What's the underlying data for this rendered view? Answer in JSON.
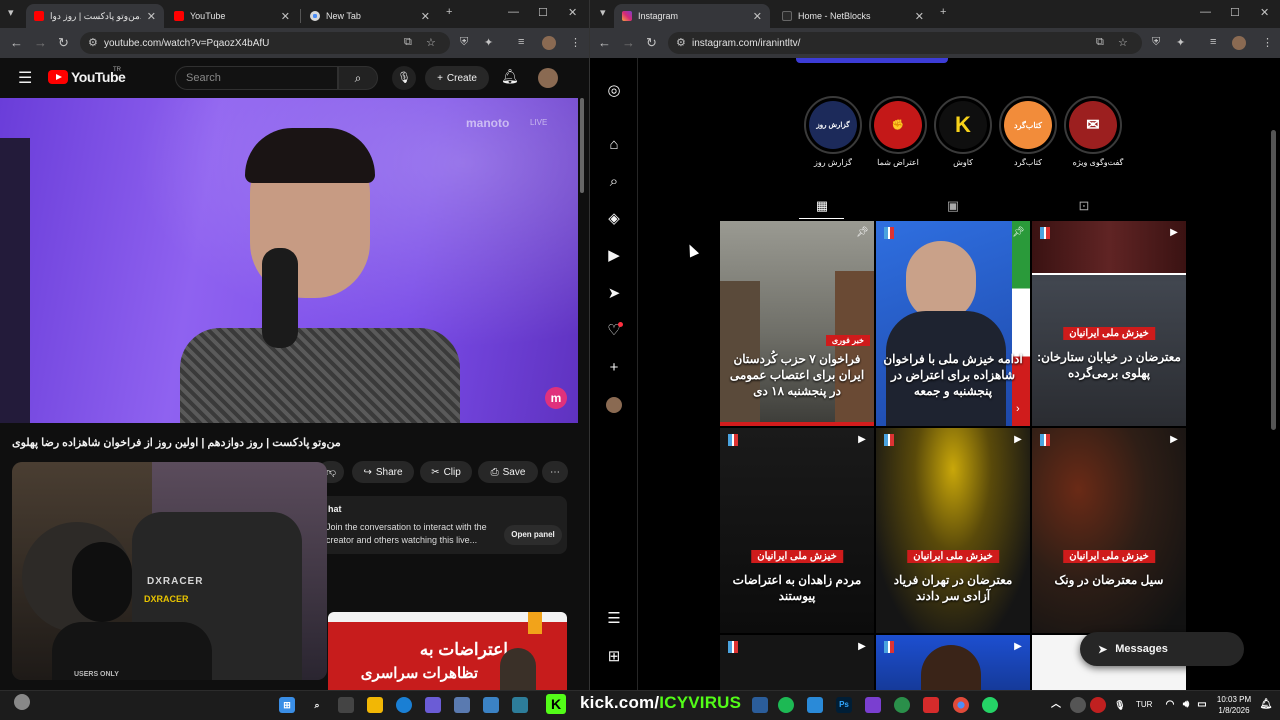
{
  "left_browser": {
    "tabs": [
      {
        "label": "من‌وتو پادکست | روز دوا...",
        "favicon": "youtube-red"
      },
      {
        "label": "YouTube",
        "favicon": "youtube-red"
      },
      {
        "label": "New Tab",
        "favicon": "chrome"
      }
    ],
    "url": "youtube.com/watch?v=PqaozX4bAfU"
  },
  "right_browser": {
    "tabs": [
      {
        "label": "Instagram",
        "favicon": "instagram"
      },
      {
        "label": "Home - NetBlocks",
        "favicon": "netblocks"
      }
    ],
    "url": "instagram.com/iranintltv/"
  },
  "youtube": {
    "logo_text": "YouTube",
    "logo_sup": "TR",
    "search_placeholder": "Search",
    "create_label": "Create",
    "watermark": "manoto",
    "watermark_live": "LIVE",
    "video_title": "من‌وتو پادکست | روز دوازدهم | اولین روز از فراخوان شاهزاده رضا پهلوی",
    "actions": {
      "share": "Share",
      "clip": "Clip",
      "save": "Save"
    },
    "chat": {
      "heading": "hat",
      "text": "Join the conversation to interact with the creator and others watching this live...",
      "open_panel": "Open panel"
    },
    "ad_text": "اعتراضات به",
    "ad_text2": "تظاهرات سراسری",
    "webcam_brand": "DXRACER",
    "webcam_brand2": "DXRACER",
    "webcam_footer": "USERS ONLY"
  },
  "instagram": {
    "highlights": [
      {
        "label": "گزارش روز",
        "icon_text": "گزارش روز",
        "bg": "#1c2a5a"
      },
      {
        "label": "اعتراض شما",
        "icon_text": "✊",
        "bg": "#c41818"
      },
      {
        "label": "کاوش",
        "icon_text": "K",
        "bg": "#0f0f0f"
      },
      {
        "label": "کتاب‌گرد",
        "icon_text": "کتاب‌گرد",
        "bg": "#f28c3a"
      },
      {
        "label": "گفت‌وگوی ویژه",
        "icon_text": "✉",
        "bg": "#9c1f1f"
      }
    ],
    "posts": [
      {
        "tag": "خبر فوری",
        "caption": "فراخوان ۷ حزب کُردستان ایران برای اعتصاب عمومی در پنجشنبه ۱۸ دی",
        "bg": "#7d7d72"
      },
      {
        "tag": "",
        "caption": "ادامه خیزش ملی با فراخوان شاهزاده برای اعتراض در پنجشنبه و جمعه",
        "bg": "#2d5fb8"
      },
      {
        "tag": "خیزش ملی ایرانیان",
        "caption": "معترضان در خیابان ستارخان: پهلوی برمی‌گرده",
        "bg": "#3a3d44"
      },
      {
        "tag": "خیزش ملی ایرانیان",
        "caption": "مردم زاهدان به اعتراضات پیوستند",
        "bg": "#151515"
      },
      {
        "tag": "خیزش ملی ایرانیان",
        "caption": "معترضان در تهران فریاد آزادی سر دادند",
        "bg": "#3b2b08"
      },
      {
        "tag": "خیزش ملی ایرانیان",
        "caption": "سیل معترضان در ونک",
        "bg": "#2e1e16"
      }
    ],
    "messages_label": "Messages"
  },
  "taskbar": {
    "kick_prefix": "kick.com/",
    "kick_user": "ICYVIRUS",
    "lang": "TUR",
    "time": "10:03 PM",
    "date": "1/8/2026"
  }
}
